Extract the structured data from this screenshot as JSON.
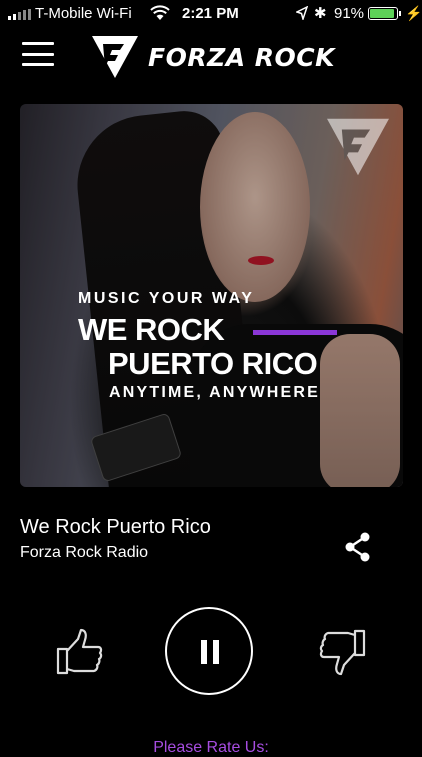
{
  "status": {
    "carrier": "T-Mobile Wi-Fi",
    "time": "2:21 PM",
    "battery_pct": "91%",
    "battery_level": 0.91,
    "battery_color": "#5ed158"
  },
  "header": {
    "logo_text": "FORZA ROCK",
    "menu_icon": "hamburger-icon",
    "logo_icon": "forza-rock-emblem-icon"
  },
  "artwork": {
    "line1": "MUSIC YOUR WAY",
    "line2": "WE ROCK",
    "line3": "PUERTO RICO",
    "line4": "ANYTIME, ANYWHERE",
    "accent_color": "#8a36d6"
  },
  "now_playing": {
    "title": "We Rock Puerto Rico",
    "artist": "Forza Rock Radio",
    "share_icon": "share-icon"
  },
  "controls": {
    "like_icon": "thumbs-up-icon",
    "play_state_icon": "pause-icon",
    "dislike_icon": "thumbs-down-icon"
  },
  "footer": {
    "rate_label": "Please Rate Us:",
    "link_color": "#a64de0"
  }
}
